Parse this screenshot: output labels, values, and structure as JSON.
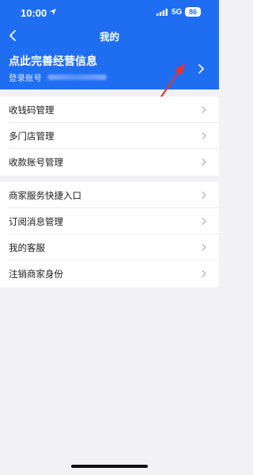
{
  "status_bar": {
    "time": "10:00",
    "network": "5G",
    "battery": "86"
  },
  "nav": {
    "title": "我的"
  },
  "profile": {
    "title": "点此完善经营信息",
    "account_label": "登录账号"
  },
  "menu_groups": [
    {
      "items": [
        {
          "label": "收钱码管理"
        },
        {
          "label": "多门店管理"
        },
        {
          "label": "收款账号管理"
        }
      ]
    },
    {
      "items": [
        {
          "label": "商家服务快捷入口"
        },
        {
          "label": "订阅消息管理"
        },
        {
          "label": "我的客服"
        },
        {
          "label": "注销商家身份"
        }
      ]
    }
  ],
  "colors": {
    "header_blue": "#1f6ef2",
    "background": "#f2f2f4",
    "annotation_red": "#e8322b"
  },
  "icons": [
    "location-arrow-icon",
    "cellular-signal-icon",
    "back-chevron-icon",
    "chevron-right-icon",
    "annotation-arrow-icon"
  ]
}
